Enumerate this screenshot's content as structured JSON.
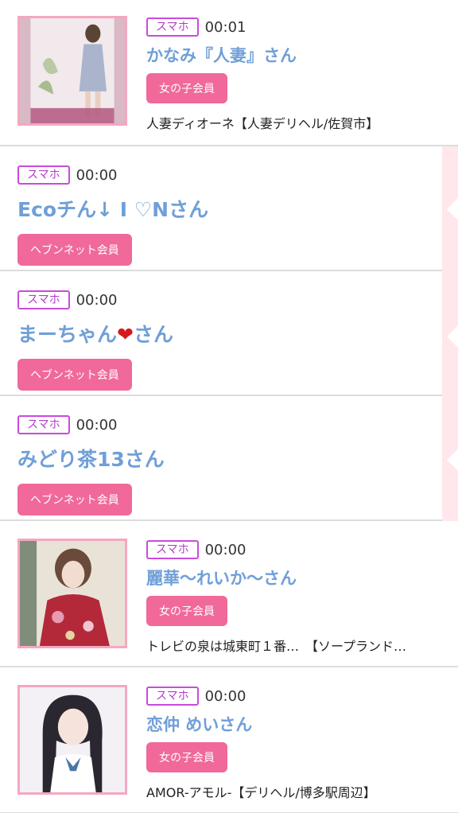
{
  "items": [
    {
      "device": "スマホ",
      "time": "00:01",
      "name": "かなみ『人妻』さん",
      "member": "女の子会員",
      "shop": "人妻ディオーネ【人妻デリヘル/佐賀市】",
      "thumb": "woman-photo-dione"
    },
    {
      "device": "スマホ",
      "time": "00:00",
      "name": "Ecoチん↓ I ♡Nさん",
      "member": "ヘブンネット会員"
    },
    {
      "device": "スマホ",
      "time": "00:00",
      "name_prefix": "まーちゃん",
      "name_heart": "❤",
      "name_suffix": "さん",
      "member": "ヘブンネット会員"
    },
    {
      "device": "スマホ",
      "time": "00:00",
      "name": "みどり茶13さん",
      "member": "ヘブンネット会員"
    },
    {
      "device": "スマホ",
      "time": "00:00",
      "name": "麗華〜れいか〜さん",
      "member": "女の子会員",
      "shop": "トレビの泉は城東町１番…　【ソープランド…",
      "thumb": "woman-photo-reika"
    },
    {
      "device": "スマホ",
      "time": "00:00",
      "name": "恋仲 めいさん",
      "member": "女の子会員",
      "shop": "AMOR-アモル-【デリヘル/博多駅周辺】",
      "thumb": "woman-photo-amor"
    }
  ],
  "colors": {
    "device_border": "#c94bdc",
    "name": "#6f9fd8",
    "member_bg": "#f0699a",
    "thumb_border": "#f5a7c0",
    "band": "#ffe7ec"
  }
}
